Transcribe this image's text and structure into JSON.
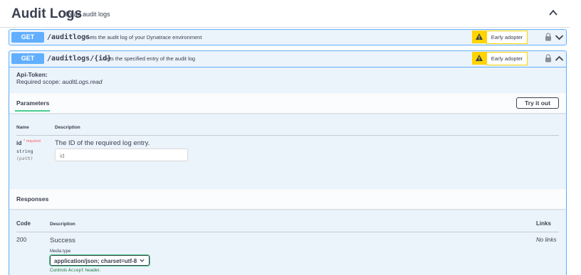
{
  "tag": {
    "title": "Audit Logs",
    "description": "Read audit logs"
  },
  "operations": [
    {
      "method": "GET",
      "path": "/auditlogs",
      "summary": "Gets the audit log of your Dynatrace environment",
      "badge": "Early adopter"
    },
    {
      "method": "GET",
      "path": "/auditlogs/{id}",
      "summary": "Gets the specified entry of the audit log",
      "badge": "Early adopter",
      "auth": {
        "label": "Api-Token:",
        "scope_prefix": "Required scope:",
        "scope_value": "auditLogs.read"
      },
      "parameters": {
        "tab_label": "Parameters",
        "try_label": "Try it out",
        "col_name": "Name",
        "col_description": "Description",
        "items": [
          {
            "name": "id",
            "required_mark": "* required",
            "type": "string",
            "in": "(path)",
            "description": "The ID of the required log entry.",
            "placeholder": "id"
          }
        ]
      },
      "responses": {
        "title": "Responses",
        "col_code": "Code",
        "col_description": "Description",
        "col_links": "Links",
        "items": [
          {
            "code": "200",
            "description": "Success",
            "links": "No links",
            "media_type_label": "Media type",
            "media_type_value": "application/json; charset=utf-8",
            "controls_prefix": "Controls",
            "controls_header": "Accept",
            "controls_suffix": "header."
          }
        ]
      }
    }
  ],
  "colors": {
    "get_accent": "#61affe",
    "get_background": "#ebf3fb",
    "early_adopter": "#ffd400",
    "selected_tab": "#49cc90"
  },
  "icons": [
    "collapse-chevron-up-icon",
    "warning-icon",
    "lock-icon",
    "chevron-down-icon",
    "chevron-up-icon"
  ]
}
